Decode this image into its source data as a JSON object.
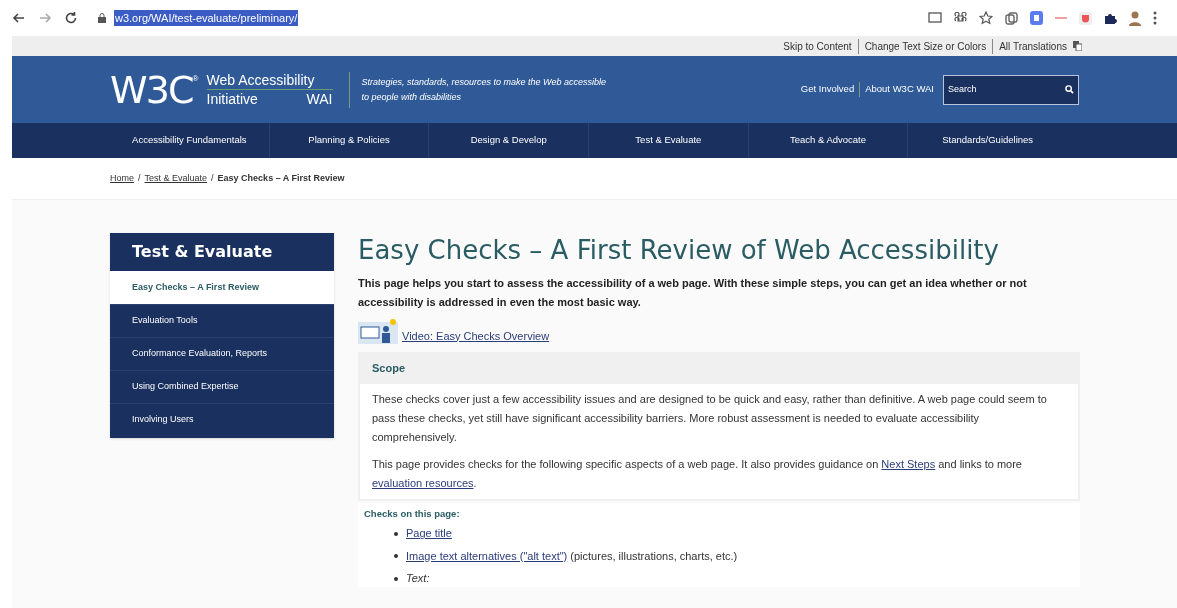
{
  "browser": {
    "url": "w3.org/WAI/test-evaluate/preliminary/"
  },
  "utility_links": [
    "Skip to Content",
    "Change Text Size or Colors",
    "All Translations"
  ],
  "header": {
    "logo_mark": "W3C",
    "logo_reg": "®",
    "logo_line1": "Web Accessibility",
    "logo_line2": "Initiative",
    "logo_abbr": "WAI",
    "tagline": "Strategies, standards, resources to make the Web accessible to people with disabilities",
    "links": [
      "Get Involved",
      "About W3C WAI"
    ],
    "search": {
      "placeholder": "Search"
    }
  },
  "nav": [
    {
      "label": "Accessibility Fundamentals"
    },
    {
      "label": "Planning & Policies"
    },
    {
      "label": "Design & Develop"
    },
    {
      "label": "Test & Evaluate"
    },
    {
      "label": "Teach & Advocate"
    },
    {
      "label": "Standards/Guidelines"
    }
  ],
  "breadcrumb_separator": "/",
  "breadcrumb": [
    {
      "label": "Home",
      "link": true
    },
    {
      "label": "Test & Evaluate",
      "link": true
    },
    {
      "label": "Easy Checks – A First Review",
      "link": false
    }
  ],
  "sidebar": {
    "title": "Test & Evaluate",
    "items": [
      {
        "label": "Easy Checks – A First Review",
        "selected": true
      },
      {
        "label": "Evaluation Tools",
        "selected": false
      },
      {
        "label": "Conformance Evaluation, Reports",
        "selected": false
      },
      {
        "label": "Using Combined Expertise",
        "selected": false
      },
      {
        "label": "Involving Users",
        "selected": false
      }
    ]
  },
  "title": "Easy Checks – A First Review of Web Accessibility",
  "intro": "This page helps you start to assess the accessibility of a web page. With these simple steps, you can get an idea whether or not accessibility is addressed in even the most basic way.",
  "video_link": "Video: Easy Checks Overview",
  "scope": {
    "heading": "Scope",
    "paragraphs": [
      [
        {
          "text": "These checks cover just a few accessibility issues and are designed to be quick and easy, rather than definitive. A web page could seem to pass these checks, yet still have significant accessibility barriers. More robust assessment is needed to evaluate accessibility comprehensively.",
          "kind": "plain"
        }
      ],
      [
        {
          "text": "This page provides checks for the following specific aspects of a web page. It also provides guidance on ",
          "kind": "plain"
        },
        {
          "text": "Next Steps",
          "kind": "link"
        },
        {
          "text": " and links to more ",
          "kind": "plain"
        },
        {
          "text": "evaluation resources",
          "kind": "link"
        },
        {
          "text": ".",
          "kind": "plain"
        }
      ]
    ]
  },
  "checks": {
    "heading": "Checks on this page:",
    "items": [
      [
        {
          "text": "Page title",
          "kind": "link"
        }
      ],
      [
        {
          "text": "Image text alternatives (\"alt text\")",
          "kind": "link"
        },
        {
          "text": " (pictures, illustrations, charts, etc.)",
          "kind": "plain"
        }
      ],
      [
        {
          "text": "Text:",
          "kind": "italic"
        }
      ]
    ]
  }
}
